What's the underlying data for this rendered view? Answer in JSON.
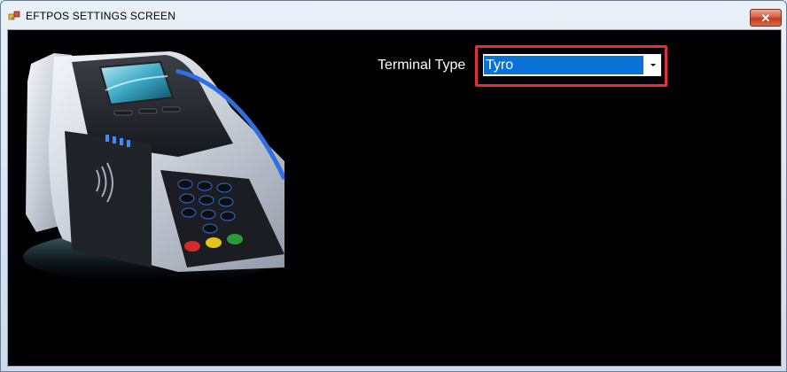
{
  "window": {
    "title": "EFTPOS SETTINGS SCREEN",
    "close_glyph": "✕"
  },
  "form": {
    "terminal_type_label": "Terminal Type",
    "terminal_type_value": "Tyro"
  },
  "colors": {
    "client_background": "#000000",
    "selection_blue": "#0a72d6",
    "highlight_red": "#e0303a"
  },
  "icons": {
    "app": "app-icon",
    "close": "close-icon",
    "dropdown": "chevron-down-icon"
  }
}
